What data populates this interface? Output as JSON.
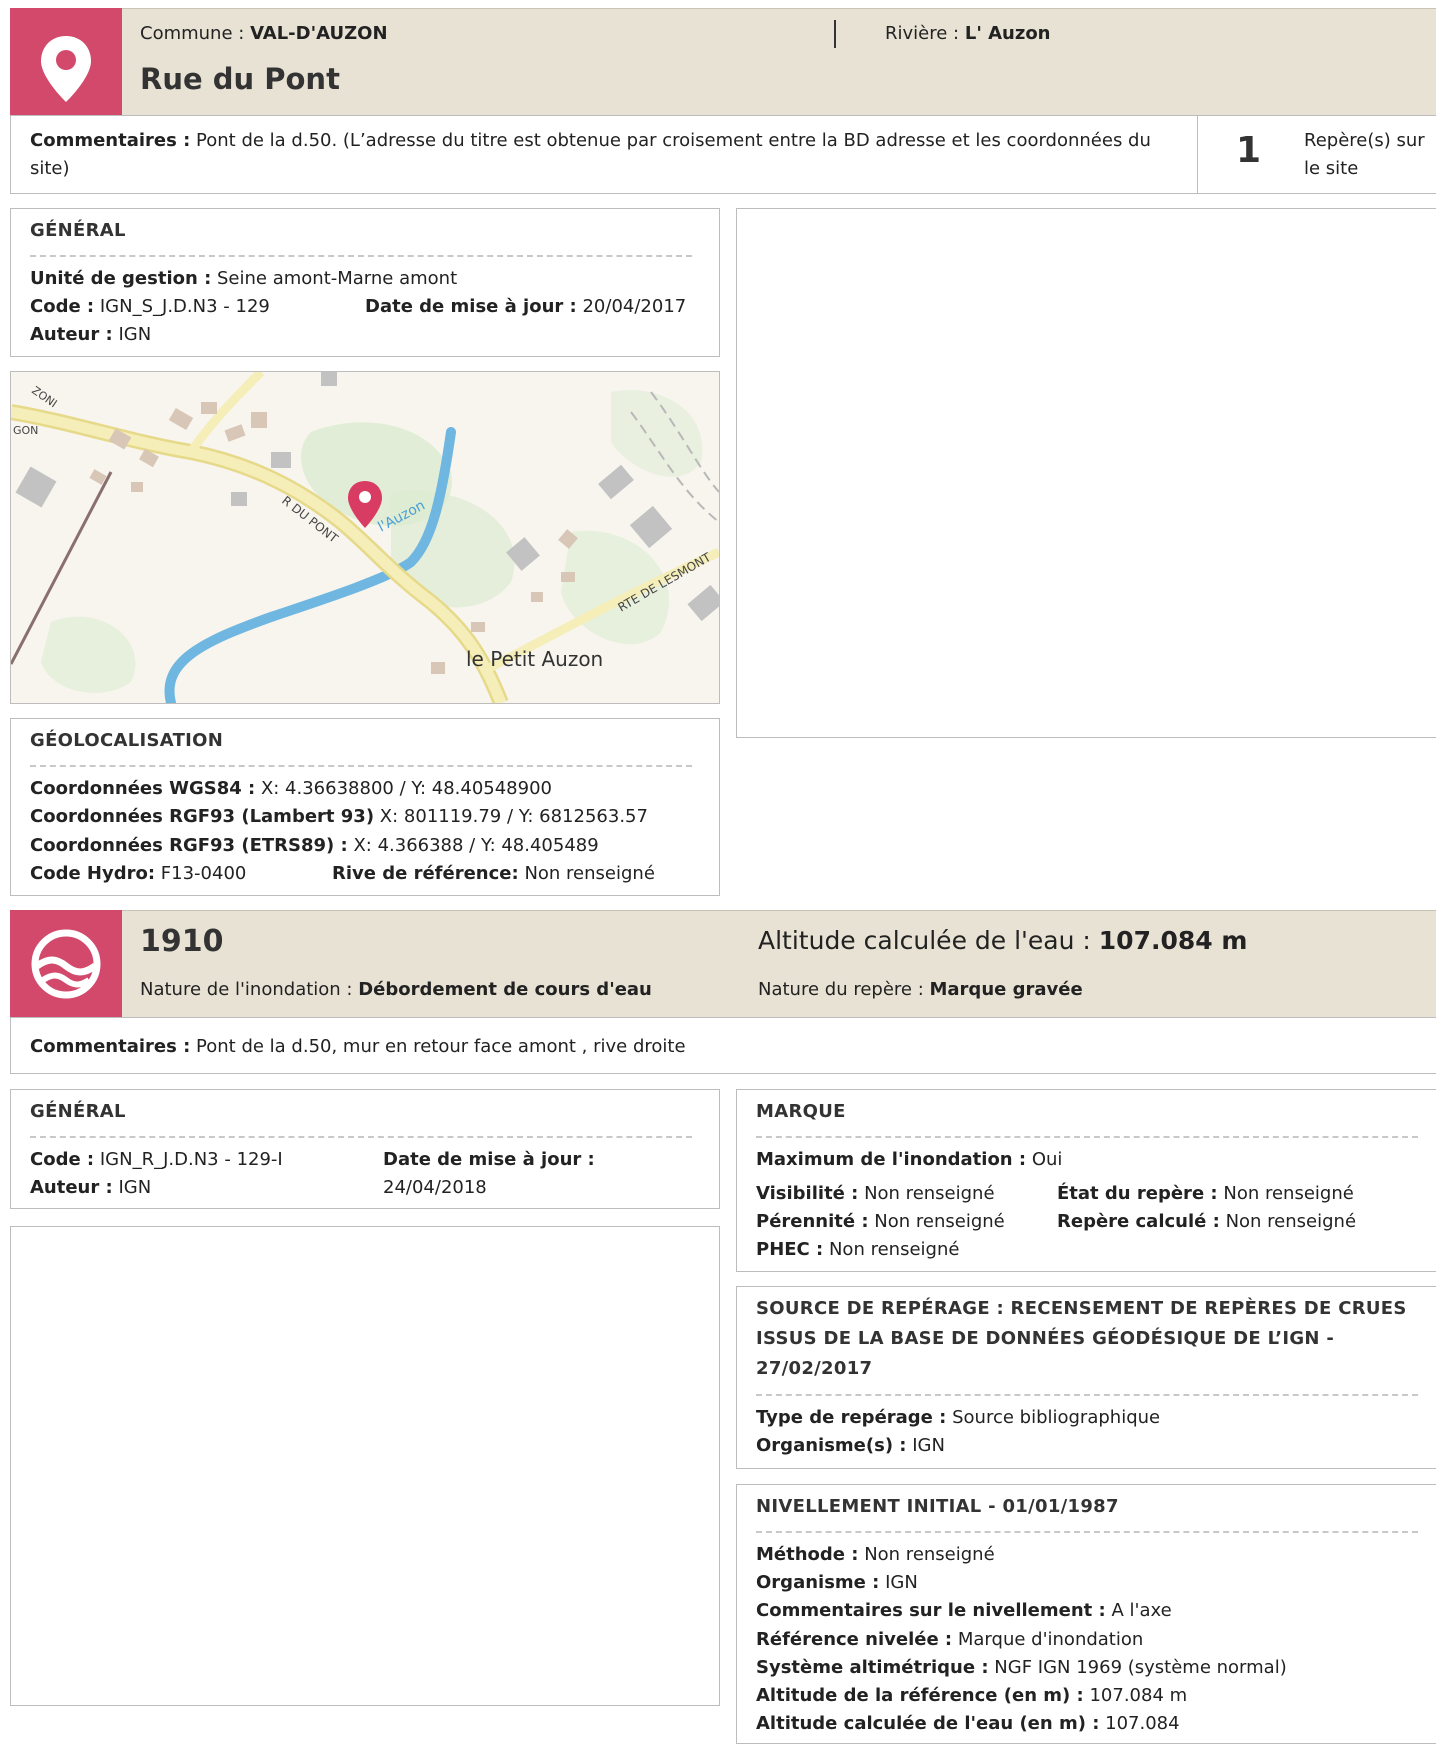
{
  "site": {
    "commune_label": "Commune :",
    "commune": "VAL-D'AUZON",
    "riviere_label": "Rivière :",
    "riviere": "L' Auzon",
    "title": "Rue du Pont",
    "comments_label": "Commentaires :",
    "comments_line1": "Pont de la d.50. (L’adresse du titre est obtenue par croisement entre la BD adresse et les coordonnées du",
    "comments_line2": "site)",
    "reperes_count": "1",
    "reperes_label_1": "Repère(s) sur",
    "reperes_label_2": "le site"
  },
  "general": {
    "title": "GÉNÉRAL",
    "unite_label": "Unité de gestion :",
    "unite": "Seine amont-Marne amont",
    "code_label": "Code :",
    "code": "IGN_S_J.D.N3 - 129",
    "date_label": "Date de mise à jour :",
    "date": "20/04/2017",
    "auteur_label": "Auteur :",
    "auteur": "IGN"
  },
  "map": {
    "label_auzon": "l'Auzon",
    "label_rdupont": "R DU PONT",
    "label_rtelesmont": "RTE DE LESMONT",
    "label_petit_auzon": "le Petit Auzon",
    "label_zoni": "ZONI",
    "label_gon": "GON",
    "colors": {
      "road": "#f3e7a4",
      "river": "#6fb6e1",
      "marker": "#d93c62"
    }
  },
  "geoloc": {
    "title": "GÉOLOCALISATION",
    "wgs_label": "Coordonnées WGS84 :",
    "wgs": "X: 4.36638800 / Y: 48.40548900",
    "lambert_label": "Coordonnées RGF93 (Lambert 93)",
    "lambert": "X: 801119.79 / Y: 6812563.57",
    "etrs_label": "Coordonnées RGF93 (ETRS89) :",
    "etrs": "X: 4.366388 / Y: 48.405489",
    "hydro_label": "Code Hydro:",
    "hydro": "F13-0400",
    "rive_label": "Rive de référence:",
    "rive": "Non renseigné"
  },
  "repere": {
    "year": "1910",
    "altitude_label": "Altitude calculée de l'eau :",
    "altitude": "107.084 m",
    "nature_inond_label": "Nature de l'inondation :",
    "nature_inond": "Débordement de cours d'eau",
    "nature_repere_label": "Nature du repère :",
    "nature_repere": "Marque gravée",
    "comments_label": "Commentaires :",
    "comments": "Pont de la d.50, mur en retour face amont , rive droite"
  },
  "general2": {
    "title": "GÉNÉRAL",
    "code_label": "Code :",
    "code": "IGN_R_J.D.N3 - 129-I",
    "date_label": "Date de mise à jour :",
    "date": "24/04/2018",
    "auteur_label": "Auteur :",
    "auteur": "IGN"
  },
  "marque": {
    "title": "MARQUE",
    "max_label": "Maximum de l'inondation :",
    "max": "Oui",
    "visib_label": "Visibilité :",
    "visib": "Non renseigné",
    "etat_label": "État du repère :",
    "etat": "Non renseigné",
    "peren_label": "Pérennité :",
    "peren": "Non renseigné",
    "calc_label": "Repère calculé :",
    "calc": "Non renseigné",
    "phec_label": "PHEC :",
    "phec": "Non renseigné"
  },
  "source": {
    "title_1": "SOURCE DE REPÉRAGE : RECENSEMENT DE REPÈRES DE CRUES",
    "title_2": "ISSUS DE LA BASE DE DONNÉES GÉODÉSIQUE DE L’IGN -",
    "title_3": "27/02/2017",
    "type_label": "Type de repérage :",
    "type": "Source bibliographique",
    "org_label": "Organisme(s) :",
    "org": "IGN"
  },
  "nivellement": {
    "title": "NIVELLEMENT INITIAL - 01/01/1987",
    "methode_label": "Méthode :",
    "methode": "Non renseigné",
    "org_label": "Organisme :",
    "org": "IGN",
    "comm_label": "Commentaires sur le nivellement :",
    "comm": "A l'axe",
    "ref_label": "Référence nivelée :",
    "ref": "Marque d'inondation",
    "sys_label": "Système altimétrique :",
    "sys": "NGF IGN 1969 (système normal)",
    "altref_label": "Altitude de la référence (en m) :",
    "altref": "107.084 m",
    "alteau_label": "Altitude calculée de l'eau (en m) :",
    "alteau": "107.084"
  }
}
